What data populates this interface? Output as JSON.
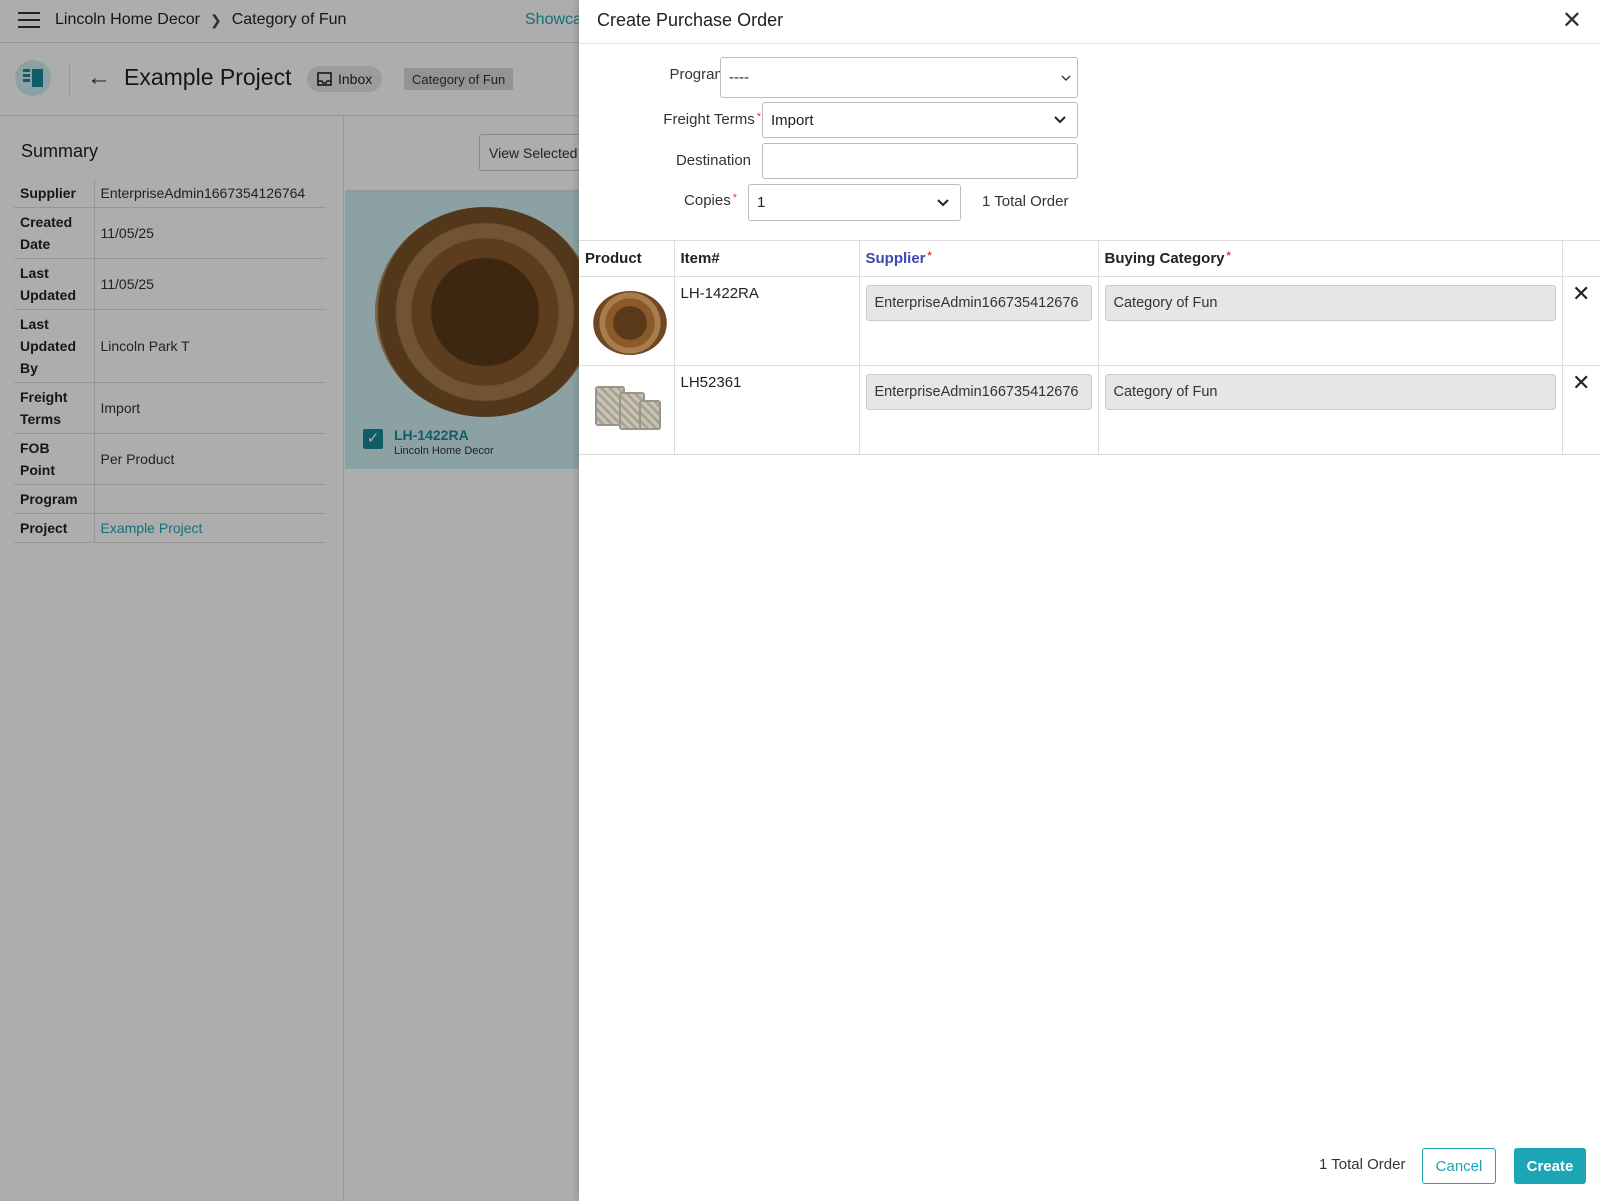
{
  "topbar": {
    "breadcrumb": [
      "Lincoln Home Decor",
      "Category of Fun"
    ],
    "showcase_label": "Showca"
  },
  "project": {
    "title": "Example Project",
    "inbox_label": "Inbox",
    "category_chip": "Category of Fun"
  },
  "summary": {
    "title": "Summary",
    "rows": [
      {
        "key": "Supplier",
        "value": "EnterpriseAdmin1667354126764"
      },
      {
        "key": "Created Date",
        "value": "11/05/25"
      },
      {
        "key": "Last Updated",
        "value": "11/05/25"
      },
      {
        "key": "Last Updated By",
        "value": "Lincoln Park T"
      },
      {
        "key": "Freight Terms",
        "value": "Import"
      },
      {
        "key": "FOB Point",
        "value": "Per Product"
      },
      {
        "key": "Program",
        "value": ""
      },
      {
        "key": "Project",
        "value": "Example Project"
      }
    ]
  },
  "content": {
    "view_selected_label": "View Selected",
    "tile": {
      "sku": "LH-1422RA",
      "brand": "Lincoln Home Decor"
    }
  },
  "drawer": {
    "title": "Create Purchase Order",
    "form": {
      "program_label": "Program",
      "program_value": "----",
      "freight_label": "Freight Terms",
      "freight_value": "Import",
      "destination_label": "Destination",
      "destination_value": "",
      "copies_label": "Copies",
      "copies_value": "1",
      "total_order_text": "1 Total Order"
    },
    "table": {
      "headers": [
        "Product",
        "Item#",
        "Supplier",
        "Buying Category"
      ],
      "rows": [
        {
          "item": "LH-1422RA",
          "supplier": "EnterpriseAdmin166735412676",
          "category": "Category of Fun"
        },
        {
          "item": "LH52361",
          "supplier": "EnterpriseAdmin166735412676",
          "category": "Category of Fun"
        }
      ]
    },
    "footer": {
      "total_order_text": "1 Total Order",
      "cancel_label": "Cancel",
      "create_label": "Create"
    }
  },
  "colors": {
    "accent": "#1ba5b5",
    "required": "#e53935",
    "supplier_header": "#3a4bb0"
  }
}
